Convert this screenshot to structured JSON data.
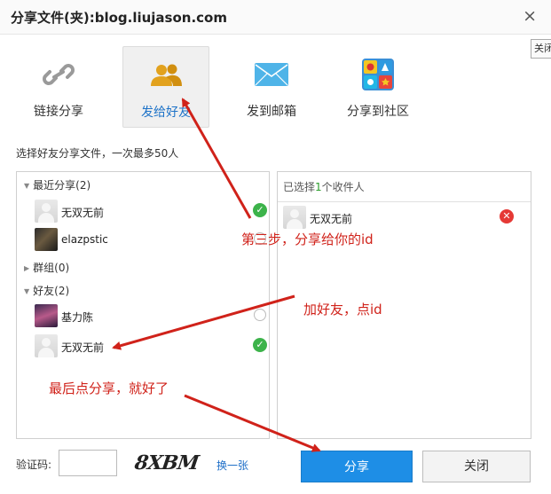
{
  "dialog": {
    "title": "分享文件(夹):blog.liujason.com",
    "close_glyph": "×",
    "edge_tag": "关闭"
  },
  "tabs": [
    {
      "label": "链接分享",
      "icon": "link-icon",
      "active": false
    },
    {
      "label": "发给好友",
      "icon": "friends-icon",
      "active": true
    },
    {
      "label": "发到邮箱",
      "icon": "mail-icon",
      "active": false
    },
    {
      "label": "分享到社区",
      "icon": "community-icon",
      "active": false
    }
  ],
  "hint": "选择好友分享文件，一次最多50人",
  "friends": {
    "recent": {
      "label": "最近分享(2)",
      "items": [
        {
          "name": "无双无前",
          "avatar": "default",
          "selected": true
        },
        {
          "name": "elazpstic",
          "avatar": "photo",
          "selected": false
        }
      ]
    },
    "groups": {
      "label": "群组(0)"
    },
    "buddies": {
      "label": "好友(2)",
      "items": [
        {
          "name": "基力陈",
          "avatar": "photo",
          "selected": false
        },
        {
          "name": "无双无前",
          "avatar": "default",
          "selected": true
        }
      ]
    }
  },
  "recipients": {
    "head_prefix": "已选择",
    "count": "1",
    "head_suffix": "个收件人",
    "items": [
      {
        "name": "无双无前"
      }
    ]
  },
  "captcha": {
    "label": "验证码:",
    "value": "",
    "image_text": "8XBM",
    "refresh": "换一张"
  },
  "buttons": {
    "share": "分享",
    "close": "关闭"
  },
  "annotations": {
    "step3": "第三步，分享给你的id",
    "add_friend": "加好友，点id",
    "final": "最后点分享，就好了"
  },
  "colors": {
    "accent": "#1e8ee6",
    "annotation": "#d0221a",
    "check": "#3cb34a",
    "remove": "#e53935"
  }
}
